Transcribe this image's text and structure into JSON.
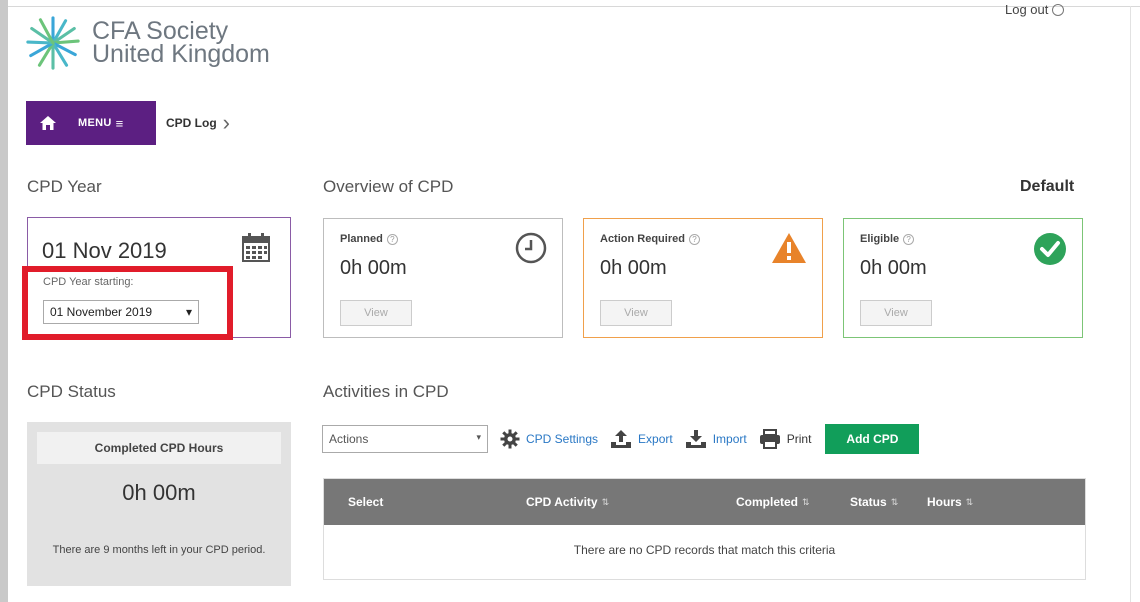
{
  "header": {
    "logo_line1": "CFA Society",
    "logo_line2": "United Kingdom",
    "logout_label": "Log out"
  },
  "nav": {
    "menu_label": "MENU",
    "breadcrumb": "CPD Log"
  },
  "cpd_year": {
    "heading": "CPD Year",
    "date": "01 Nov 2019",
    "starting_label": "CPD Year starting:",
    "selected": "01 November 2019"
  },
  "overview": {
    "heading": "Overview of CPD",
    "default_label": "Default",
    "cards": [
      {
        "title": "Planned",
        "value": "0h 00m",
        "button": "View",
        "icon": "clock-icon",
        "color": "#bdbdbd"
      },
      {
        "title": "Action Required",
        "value": "0h 00m",
        "button": "View",
        "icon": "warning-icon",
        "color": "#f0a04b"
      },
      {
        "title": "Eligible",
        "value": "0h 00m",
        "button": "View",
        "icon": "check-circle-icon",
        "color": "#7cc576"
      }
    ]
  },
  "status": {
    "heading": "CPD Status",
    "box_title": "Completed CPD Hours",
    "value": "0h 00m",
    "note": "There are 9 months left in your CPD period."
  },
  "activities": {
    "heading": "Activities in CPD",
    "actions_selected": "Actions",
    "settings_label": "CPD Settings",
    "export_label": "Export",
    "import_label": "Import",
    "print_label": "Print",
    "add_label": "Add CPD",
    "columns": [
      "Select",
      "CPD Activity",
      "Completed",
      "Status",
      "Hours"
    ],
    "empty_message": "There are no CPD records that match this criteria"
  },
  "colors": {
    "brand_purple": "#5c1f82",
    "highlight_red": "#e11c2a",
    "add_green": "#119e5a",
    "link_blue": "#2a78c5"
  }
}
